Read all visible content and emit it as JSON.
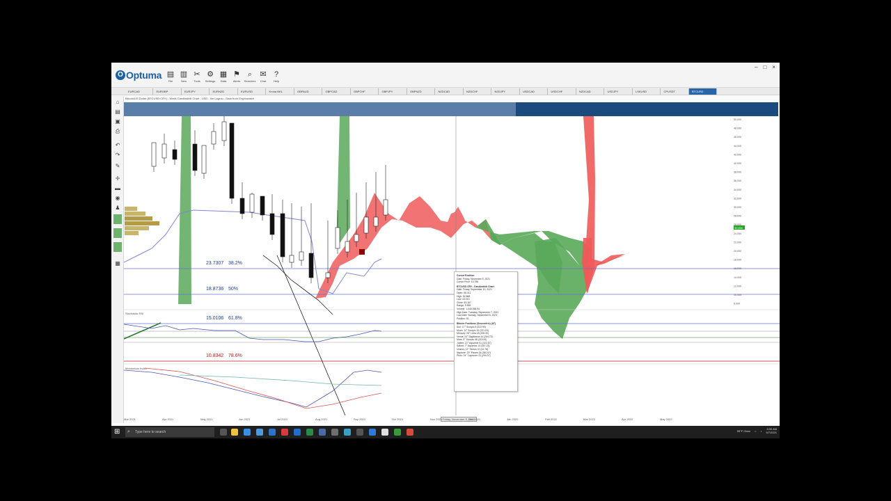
{
  "app": {
    "name": "Optuma",
    "ribbon": [
      {
        "label": "File",
        "icon": "folder-icon"
      },
      {
        "label": "New",
        "icon": "new-file-icon"
      },
      {
        "label": "Tools",
        "icon": "tools-icon"
      },
      {
        "label": "Settings",
        "icon": "settings-icon"
      },
      {
        "label": "Data",
        "icon": "data-icon"
      },
      {
        "label": "Alerts",
        "icon": "alert-icon"
      },
      {
        "label": "Searches",
        "icon": "search-icon"
      },
      {
        "label": "Chat",
        "icon": "chat-icon"
      },
      {
        "label": "Help",
        "icon": "help-icon"
      }
    ],
    "window_controls": [
      "–",
      "□",
      "×"
    ]
  },
  "tabs": [
    "EURCAD",
    "EURGBP",
    "EURJPY",
    "EURNZD",
    "EURUSD",
    "Krona NKL",
    "GBPAUD",
    "GBPCAD",
    "GBPCHF",
    "GBPJPY",
    "GBPNZD",
    "NZDCAD",
    "NZDCHF",
    "NZDJPY",
    "USDCAD",
    "USDCHF",
    "NZDCAD",
    "USDJPY",
    "LSKUSD",
    "CPUSDT",
    "BTCUSD"
  ],
  "active_tab_index": 20,
  "chart_title": "Bitcoin/US Dollar (BTCUSD:CRY) - Week Candlestick Chart - USD - Ike Lagrou - Data from Cryptowatch",
  "fib_levels": [
    {
      "price": "23.7307",
      "pct": "38.2%",
      "color": "#1f3e8f"
    },
    {
      "price": "18.8736",
      "pct": "50%",
      "color": "#1f3e8f"
    },
    {
      "price": "15.0106",
      "pct": "61.8%",
      "color": "#1f3e8f"
    },
    {
      "price": "10.8342",
      "pct": "78.6%",
      "color": "#b22222"
    }
  ],
  "panels": {
    "stochastic": "Stochastic RSI",
    "momentum": "Momentum Index"
  },
  "price_axis": [
    "50.000",
    "48.000",
    "46.000",
    "44.000",
    "42.000",
    "40.000",
    "38.000",
    "36.000",
    "34.000",
    "32.000",
    "30.000",
    "28.000",
    "26.000",
    "24.000",
    "22.000",
    "20.000",
    "18.000",
    "16.000",
    "14.000",
    "12.000",
    "10.000",
    "8.000"
  ],
  "current_price": "39.800",
  "tooltip": {
    "title": "Cursor Position",
    "lines1": [
      "Date: Friday, November 5, 2021",
      "Cursor Price: 13.786"
    ],
    "section2": "BTCUSD.CRY - Candlestick Chart",
    "lines2": [
      "Date: Friday, September 10, 2021",
      "Open: 46.012",
      "High: 52.868",
      "Low: 43.013",
      "Close: 45.167",
      "Range: 9.855",
      "Volume: 1,045,066.94",
      "High Date: Tuesday, September 7, 2021",
      "Low Date: Sunday, September 5, 2021",
      "Position: 81"
    ],
    "section3": "Bitcoin Positions (Geocentric) (AT)",
    "lines3": [
      "Sun: 17° Scorpio 5 (222.99)",
      "Moon: 11° Scorpio 32 (221.53)",
      "Mercury: 28° Libra 18 (208.30)",
      "Venus: 24° Sagittarius 44 (264.73)",
      "Mars: 5° Scorpio 48 (215.81)",
      "Jupiter: 21° Aquarius 51 (322.87)",
      "Saturn: 7° Aquarius 14 (307.23)",
      "Uranus: 11° Taurus 47 (41.78)",
      "Neptune: 20° Pisces 34 (350.57)",
      "Pluto: 24° Capricorn 22 (294.37)"
    ]
  },
  "x_axis_labels": [
    "Mar 2021",
    "Apr 2021",
    "May 2021",
    "Jun 2021",
    "Jul 2021",
    "Aug 2021",
    "Sep 2021",
    "Oct 2021",
    "Nov 2021",
    "Dec 2021",
    "Jan 2022",
    "Feb 2022",
    "Mar 2022",
    "Apr 2022",
    "May 2022"
  ],
  "cursor_date": "Friday, November 5, 2021",
  "taskbar": {
    "search_placeholder": "Type here to search",
    "weather": "55°F Clear",
    "time": "3:30 AM",
    "date": "9/7/2021"
  },
  "colors": {
    "cloud_green": "#5aa85a",
    "cloud_red": "#ef5a5a",
    "baseline": "#8a8fd6",
    "accent": "#1c5fa8"
  }
}
